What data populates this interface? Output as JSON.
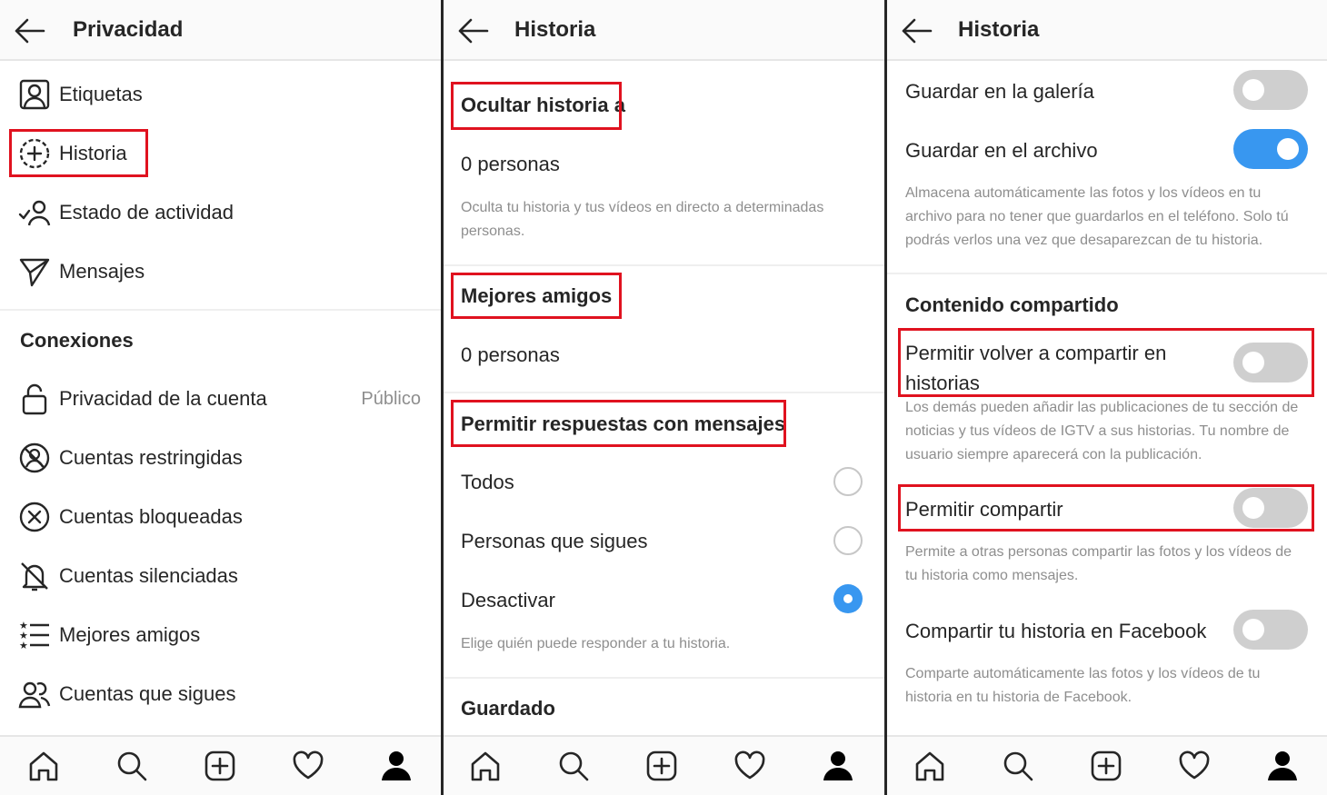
{
  "panel_privacy": {
    "title": "Privacidad",
    "items": [
      {
        "label": "Etiquetas",
        "icon": "tag-person-icon"
      },
      {
        "label": "Historia",
        "icon": "story-add-icon"
      },
      {
        "label": "Estado de actividad",
        "icon": "activity-status-icon"
      },
      {
        "label": "Mensajes",
        "icon": "direct-message-icon"
      }
    ],
    "connections_title": "Conexiones",
    "connections": [
      {
        "label": "Privacidad de la cuenta",
        "value": "Público",
        "icon": "lock-icon"
      },
      {
        "label": "Cuentas restringidas",
        "icon": "restricted-icon"
      },
      {
        "label": "Cuentas bloqueadas",
        "icon": "blocked-icon"
      },
      {
        "label": "Cuentas silenciadas",
        "icon": "muted-bell-icon"
      },
      {
        "label": "Mejores amigos",
        "icon": "close-friends-list-icon"
      },
      {
        "label": "Cuentas que sigues",
        "icon": "following-people-icon"
      }
    ]
  },
  "panel_story": {
    "title": "Historia",
    "hide_story_title": "Ocultar historia a",
    "hide_story_value": "0 personas",
    "hide_story_desc_line1": "Oculta tu historia y tus vídeos en directo a determinadas",
    "hide_story_desc_line2": "personas.",
    "close_friends_title": "Mejores amigos",
    "close_friends_value": "0 personas",
    "replies_title": "Permitir respuestas con mensajes",
    "reply_options": [
      {
        "label": "Todos",
        "selected": false
      },
      {
        "label": "Personas que sigues",
        "selected": false
      },
      {
        "label": "Desactivar",
        "selected": true
      }
    ],
    "replies_desc": "Elige quién puede responder a tu historia.",
    "saving_title": "Guardado"
  },
  "panel_story_settings": {
    "title": "Historia",
    "save_gallery_label": "Guardar en la galería",
    "save_gallery_on": false,
    "save_archive_label": "Guardar en el archivo",
    "save_archive_on": true,
    "archive_desc_line1": "Almacena automáticamente las fotos y los vídeos en tu",
    "archive_desc_line2": "archivo para no tener que guardarlos en el teléfono. Solo tú",
    "archive_desc_line3": "podrás verlos una vez que desaparezcan de tu historia.",
    "shared_content_title": "Contenido compartido",
    "allow_reshare_line1": "Permitir volver a compartir en",
    "allow_reshare_line2": "historias",
    "allow_reshare_on": false,
    "reshare_desc_line1": "Los demás pueden añadir las publicaciones de tu sección de",
    "reshare_desc_line2": "noticias y tus vídeos de IGTV a sus historias. Tu nombre de",
    "reshare_desc_line3": "usuario siempre aparecerá con la publicación.",
    "allow_sharing_label": "Permitir compartir",
    "allow_sharing_on": false,
    "sharing_desc_line1": "Permite a otras personas compartir las fotos y los vídeos de",
    "sharing_desc_line2": "tu historia como mensajes.",
    "share_facebook_label": "Compartir tu historia en Facebook",
    "share_facebook_on": false,
    "facebook_desc_line1": "Comparte automáticamente las fotos y los vídeos de tu",
    "facebook_desc_line2": "historia en tu historia de Facebook."
  },
  "tab_bar": [
    "home-icon",
    "search-icon",
    "new-post-icon",
    "activity-heart-icon",
    "profile-icon"
  ],
  "colors": {
    "highlight": "#e0121f",
    "accent_blue": "#3897f0",
    "toggle_off": "#cfcfcf",
    "secondary_text": "#8e8e8e"
  }
}
